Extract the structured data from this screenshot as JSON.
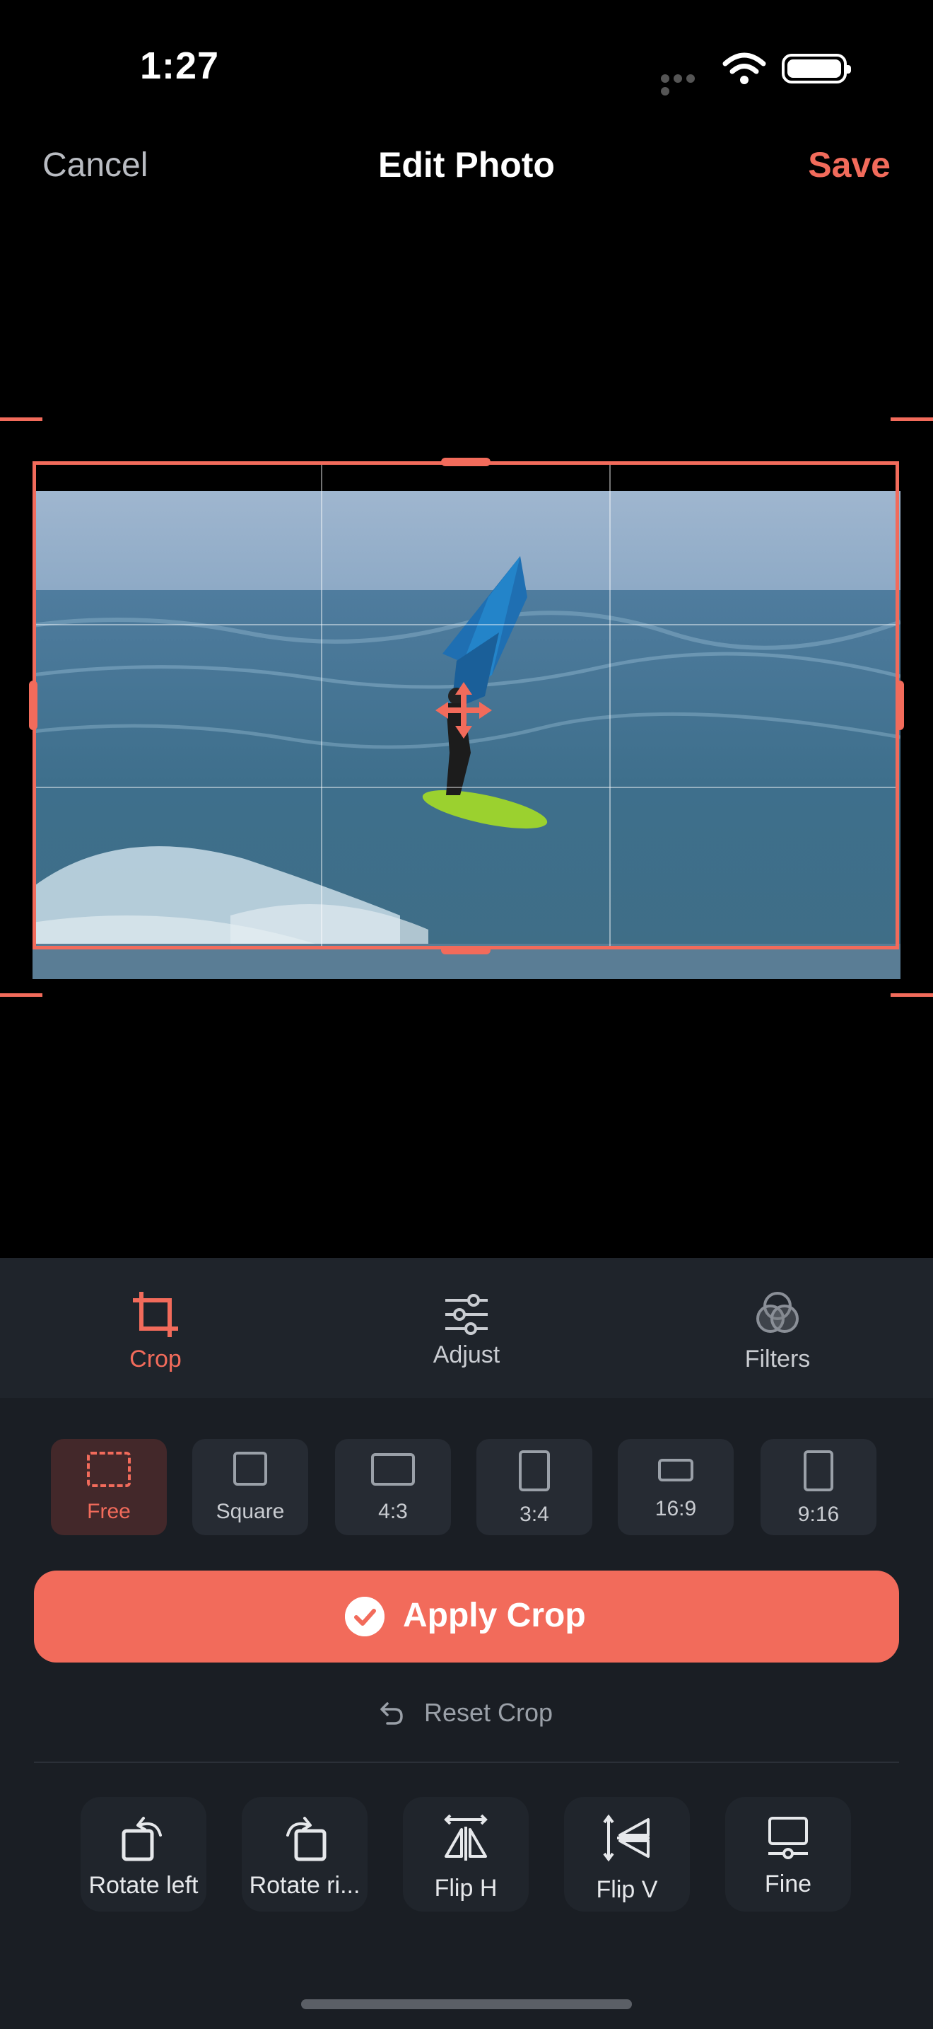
{
  "status": {
    "time": "1:27"
  },
  "nav": {
    "cancel": "Cancel",
    "title": "Edit Photo",
    "save": "Save"
  },
  "colors": {
    "accent": "#f26b5b",
    "panel": "#1a1e24",
    "tab_bg": "#1f242b"
  },
  "tabs": [
    {
      "label": "Crop",
      "icon": "crop-icon",
      "active": true
    },
    {
      "label": "Adjust",
      "icon": "sliders-icon",
      "active": false
    },
    {
      "label": "Filters",
      "icon": "filters-icon",
      "active": false
    }
  ],
  "ratios": [
    {
      "label": "Free",
      "selected": true
    },
    {
      "label": "Square",
      "selected": false
    },
    {
      "label": "4:3",
      "selected": false
    },
    {
      "label": "3:4",
      "selected": false
    },
    {
      "label": "16:9",
      "selected": false
    },
    {
      "label": "9:16",
      "selected": false
    }
  ],
  "apply": {
    "label": "Apply Crop"
  },
  "reset": {
    "label": "Reset Crop"
  },
  "tools": [
    {
      "label": "Rotate left",
      "icon": "rotate-left-icon"
    },
    {
      "label": "Rotate ri...",
      "icon": "rotate-right-icon"
    },
    {
      "label": "Flip H",
      "icon": "flip-horizontal-icon"
    },
    {
      "label": "Flip V",
      "icon": "flip-vertical-icon"
    },
    {
      "label": "Fine",
      "icon": "fine-tune-icon"
    }
  ]
}
